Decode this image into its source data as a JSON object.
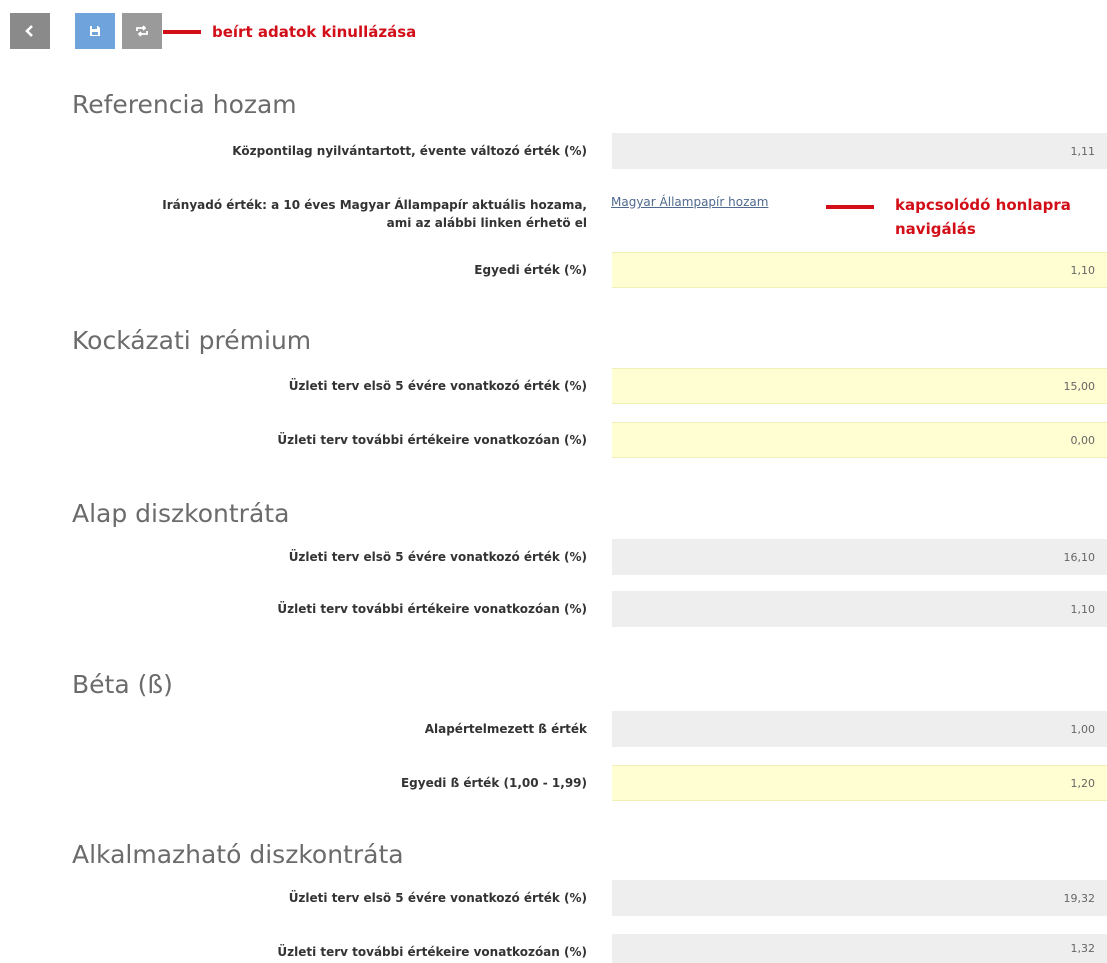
{
  "toolbar": {
    "back_icon": "chevron-left-icon",
    "save_icon": "floppy-disk-icon",
    "reset_icon": "refresh-icon",
    "reset_annotation": "beírt adatok kinullázása"
  },
  "sections": {
    "ref": {
      "title": "Referencia hozam",
      "central_label": "Központilag nyilvántartott, évente változó érték (%)",
      "central_value": "1,11",
      "guide_label_1": "Irányadó érték: a 10 éves Magyar Állampapír aktuális hozama,",
      "guide_label_2": "ami az alábbi linken érhetö el",
      "link_text": "Magyar Állampapír hozam",
      "link_annotation_1": "kapcsolódó honlapra",
      "link_annotation_2": "navigálás",
      "custom_label": "Egyedi érték (%)",
      "custom_value": "1,10"
    },
    "risk": {
      "title": "Kockázati prémium",
      "first5_label": "Üzleti terv elsö 5 évére vonatkozó érték (%)",
      "first5_value": "15,00",
      "further_label": "Üzleti terv további értékeire vonatkozóan (%)",
      "further_value": "0,00"
    },
    "base": {
      "title": "Alap diszkontráta",
      "first5_label": "Üzleti terv elsö 5 évére vonatkozó érték (%)",
      "first5_value": "16,10",
      "further_label": "Üzleti terv további értékeire vonatkozóan (%)",
      "further_value": "1,10"
    },
    "beta": {
      "title": "Béta (ß)",
      "default_label": "Alapértelmezett ß érték",
      "default_value": "1,00",
      "custom_label": "Egyedi ß érték (1,00 - 1,99)",
      "custom_value": "1,20"
    },
    "applicable": {
      "title": "Alkalmazható diszkontráta",
      "first5_label": "Üzleti terv elsö 5 évére vonatkozó érték (%)",
      "first5_value": "19,32",
      "further_label": "Üzleti terv további értékeire vonatkozóan (%)",
      "further_value": "1,32"
    }
  },
  "colors": {
    "readonly_field": "#eeeeee",
    "editable_field": "#fffed2",
    "annotation_red": "#d20f18",
    "save_button": "#6ea3dc"
  }
}
